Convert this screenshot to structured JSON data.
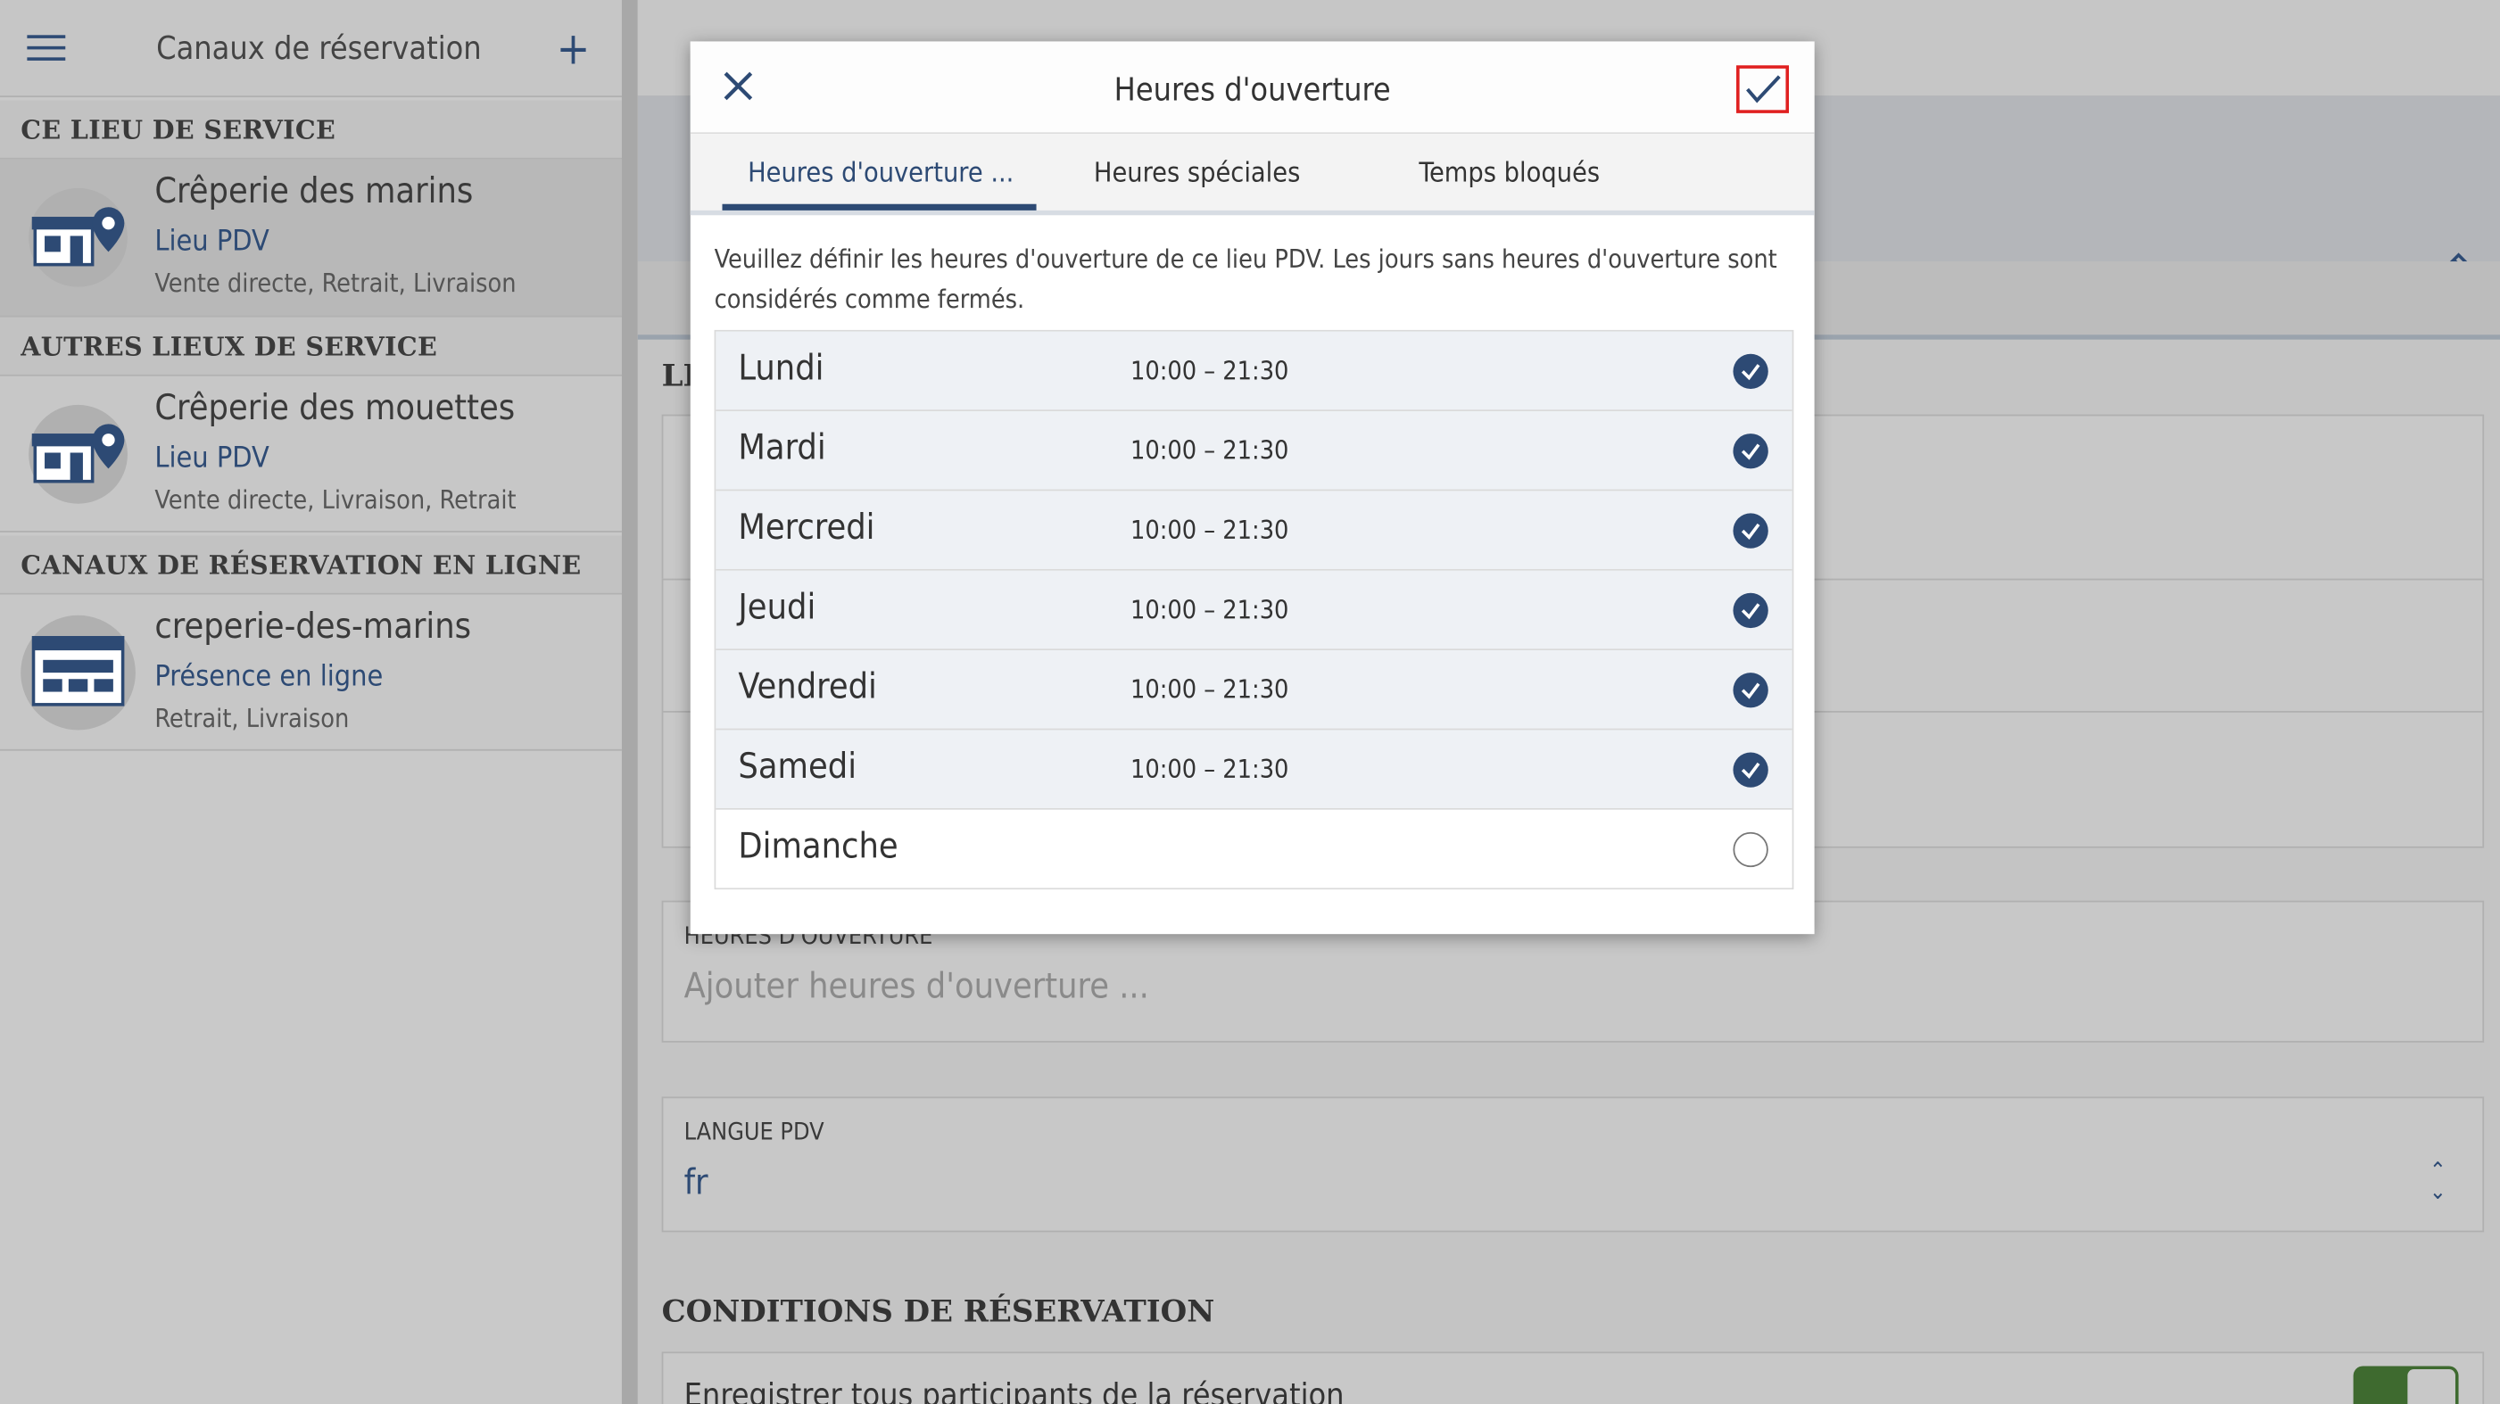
{
  "sidebar": {
    "title": "Canaux de réservation",
    "sections": [
      {
        "heading": "CE LIEU DE SERVICE"
      },
      {
        "heading": "AUTRES LIEUX DE SERVICE"
      },
      {
        "heading": "CANAUX DE RÉSERVATION EN LIGNE"
      }
    ],
    "items": [
      {
        "name": "Crêperie des marins",
        "type": "Lieu PDV",
        "services": "Vente directe, Retrait, Livraison"
      },
      {
        "name": "Crêperie des mouettes",
        "type": "Lieu PDV",
        "services": "Vente directe, Livraison, Retrait"
      },
      {
        "name": "creperie-des-marins",
        "type": "Présence en ligne",
        "services": "Retrait, Livraison"
      }
    ]
  },
  "main": {
    "partial_label": "LI",
    "opening_hours_field": {
      "label": "HEURES D'OUVERTURE",
      "placeholder": "Ajouter heures d'ouverture ..."
    },
    "language_field": {
      "label": "LANGUE PDV",
      "value": "fr"
    },
    "booking_section": {
      "heading": "CONDITIONS DE RÉSERVATION",
      "first_option": "Enregistrer tous participants de la réservation"
    }
  },
  "dialog": {
    "title": "Heures d'ouverture",
    "tabs": [
      "Heures d'ouverture ...",
      "Heures spéciales",
      "Temps bloqués"
    ],
    "description": "Veuillez définir les heures d'ouverture de ce lieu PDV. Les jours sans heures d'ouverture sont considérés comme fermés.",
    "days": [
      {
        "name": "Lundi",
        "hours": "10:00 – 21:30",
        "checked": true
      },
      {
        "name": "Mardi",
        "hours": "10:00 – 21:30",
        "checked": true
      },
      {
        "name": "Mercredi",
        "hours": "10:00 – 21:30",
        "checked": true
      },
      {
        "name": "Jeudi",
        "hours": "10:00 – 21:30",
        "checked": true
      },
      {
        "name": "Vendredi",
        "hours": "10:00 – 21:30",
        "checked": true
      },
      {
        "name": "Samedi",
        "hours": "10:00 – 21:30",
        "checked": true
      },
      {
        "name": "Dimanche",
        "hours": "",
        "checked": false
      }
    ]
  },
  "colors": {
    "accent": "#2d4a74",
    "highlight": "#e02020",
    "toggle_on": "#3e6a2f"
  }
}
